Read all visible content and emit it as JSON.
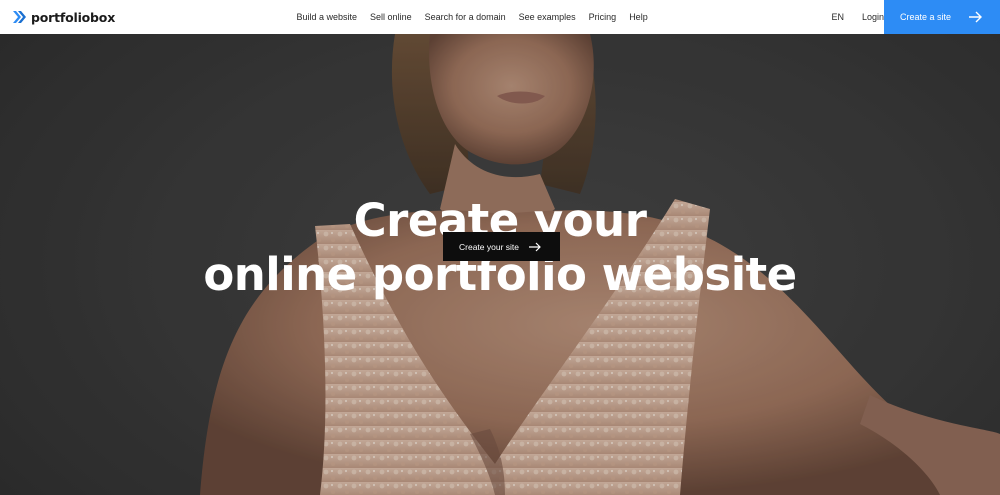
{
  "brand": {
    "name": "portfoliobox",
    "icon": "portfoliobox-logo-mark",
    "color": "#2d8cf5"
  },
  "nav": {
    "links": [
      {
        "label": "Build a website"
      },
      {
        "label": "Sell online"
      },
      {
        "label": "Search for a domain"
      },
      {
        "label": "See examples"
      },
      {
        "label": "Pricing"
      },
      {
        "label": "Help"
      }
    ],
    "language": "EN",
    "login": "Login",
    "cta": {
      "label": "Create a site",
      "icon": "arrow-right-icon",
      "color": "#2d8cf5"
    }
  },
  "hero": {
    "headline_line1": "Create your",
    "headline_line2": "online portfolio website",
    "button": {
      "label": "Create your site",
      "icon": "arrow-right-icon",
      "color": "#0d0d0d"
    },
    "image": "woman-in-lace-dress-photo"
  }
}
